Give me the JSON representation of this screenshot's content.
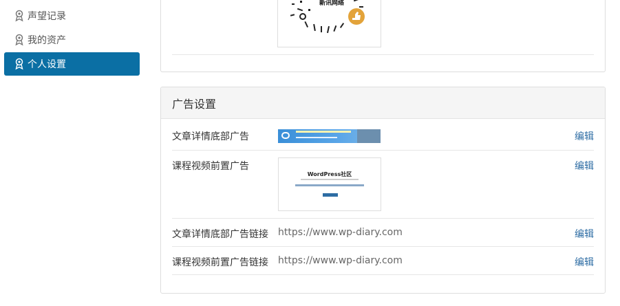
{
  "sidebar": {
    "items": [
      {
        "label": "声望记录",
        "icon": "award-icon",
        "active": false
      },
      {
        "label": "我的资产",
        "icon": "award-icon",
        "active": false
      },
      {
        "label": "个人设置",
        "icon": "award-icon",
        "active": true
      }
    ]
  },
  "top_panel": {
    "qr_image": {
      "icon": "qr-code-image",
      "caption": "新讯网络"
    }
  },
  "ad_settings": {
    "title": "广告设置",
    "rows": [
      {
        "label": "文章详情底部广告",
        "type": "banner-image",
        "edit_label": "编辑"
      },
      {
        "label": "课程视频前置广告",
        "type": "poster-image",
        "edit_label": "编辑",
        "poster_title": "WordPress社区"
      },
      {
        "label": "文章详情底部广告链接",
        "value": "https://www.wp-diary.com",
        "edit_label": "编辑"
      },
      {
        "label": "课程视频前置广告链接",
        "value": "https://www.wp-diary.com",
        "edit_label": "编辑"
      }
    ]
  },
  "colors": {
    "accent": "#0b6fa4",
    "link": "#2e6da4"
  }
}
